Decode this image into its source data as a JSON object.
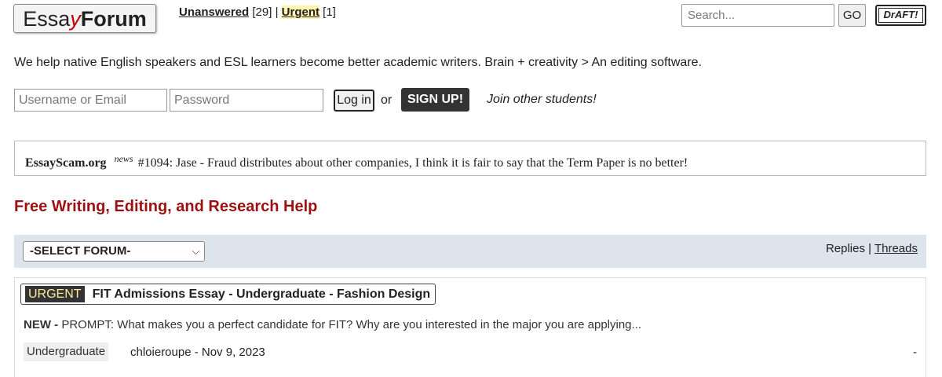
{
  "header": {
    "logo": {
      "part1": "Essa",
      "part2": "y",
      "part3": "Forum"
    },
    "unanswered_label": "Unanswered",
    "unanswered_count": "[29]",
    "separator": "|",
    "urgent_label": "Urgent",
    "urgent_count": "[1]",
    "search_placeholder": "Search...",
    "go_label": "GO",
    "draft_label": "DrAFT!"
  },
  "tagline": "We help native English speakers and ESL learners become better academic writers. Brain + creativity > An editing software.",
  "login": {
    "username_placeholder": "Username or Email",
    "password_placeholder": "Password",
    "login_label": "Log in",
    "or_text": "or",
    "signup_label": "SIGN UP!",
    "join_text": "Join other students!"
  },
  "news": {
    "site": "EssayScam.org",
    "tag": "news",
    "text": "#1094: Jase - Fraud distributes about other companies, I think it is fair to say that the Term Paper is no better!"
  },
  "section_title": "Free Writing, Editing, and Research Help",
  "forum_bar": {
    "select_value": "-SELECT FORUM-",
    "replies_label": "Replies",
    "separator": "|",
    "threads_label": "Threads"
  },
  "threads": [
    {
      "badge": "URGENT",
      "title": "FIT Admissions Essay - Undergraduate - Fashion Design",
      "new_label": "NEW -",
      "excerpt": "PROMPT: What makes you a perfect candidate for FIT? Why are you interested in the major you are applying...",
      "category": "Undergraduate",
      "author_date": "chloieroupe - Nov 9, 2023",
      "replies": "-"
    }
  ]
}
